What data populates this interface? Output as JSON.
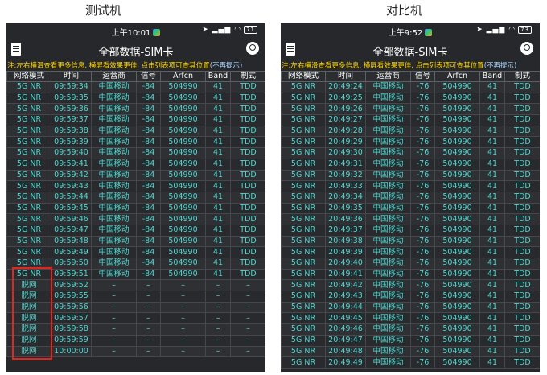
{
  "captions": {
    "left": "测试机",
    "right": "对比机"
  },
  "colors": {
    "table_text": "#4fd7d0",
    "note_text": "#ffd600",
    "highlight_border": "#e0261d",
    "background": "#26282b"
  },
  "left_phone": {
    "status_time": "上午10:01",
    "battery": "71",
    "title": "全部数据-SIM卡",
    "note": "注:左右横滑查看更多信息, 横屏看效果更佳, 点击列表项可查其位置",
    "note_link": "(不再提示)",
    "headers": [
      "网络模式",
      "时间",
      "运营商",
      "信号",
      "Arfcn",
      "Band",
      "制式"
    ],
    "rows": [
      [
        "5G NR",
        "09:59:34",
        "中国移动",
        "-84",
        "504990",
        "41",
        "TDD"
      ],
      [
        "5G NR",
        "09:59:35",
        "中国移动",
        "-84",
        "504990",
        "41",
        "TDD"
      ],
      [
        "5G NR",
        "09:59:36",
        "中国移动",
        "-84",
        "504990",
        "41",
        "TDD"
      ],
      [
        "5G NR",
        "09:59:37",
        "中国移动",
        "-84",
        "504990",
        "41",
        "TDD"
      ],
      [
        "5G NR",
        "09:59:38",
        "中国移动",
        "-84",
        "504990",
        "41",
        "TDD"
      ],
      [
        "5G NR",
        "09:59:39",
        "中国移动",
        "-84",
        "504990",
        "41",
        "TDD"
      ],
      [
        "5G NR",
        "09:59:40",
        "中国移动",
        "-84",
        "504990",
        "41",
        "TDD"
      ],
      [
        "5G NR",
        "09:59:41",
        "中国移动",
        "-84",
        "504990",
        "41",
        "TDD"
      ],
      [
        "5G NR",
        "09:59:42",
        "中国移动",
        "-84",
        "504990",
        "41",
        "TDD"
      ],
      [
        "5G NR",
        "09:59:43",
        "中国移动",
        "-84",
        "504990",
        "41",
        "TDD"
      ],
      [
        "5G NR",
        "09:59:44",
        "中国移动",
        "-84",
        "504990",
        "41",
        "TDD"
      ],
      [
        "5G NR",
        "09:59:45",
        "中国移动",
        "-84",
        "504990",
        "41",
        "TDD"
      ],
      [
        "5G NR",
        "09:59:46",
        "中国移动",
        "-84",
        "504990",
        "41",
        "TDD"
      ],
      [
        "5G NR",
        "09:59:47",
        "中国移动",
        "-84",
        "504990",
        "41",
        "TDD"
      ],
      [
        "5G NR",
        "09:59:48",
        "中国移动",
        "-84",
        "504990",
        "41",
        "TDD"
      ],
      [
        "5G NR",
        "09:59:49",
        "中国移动",
        "-84",
        "504990",
        "41",
        "TDD"
      ],
      [
        "5G NR",
        "09:59:50",
        "中国移动",
        "-84",
        "504990",
        "41",
        "TDD"
      ],
      [
        "5G NR",
        "09:59:51",
        "中国移动",
        "-84",
        "504990",
        "41",
        "TDD"
      ],
      [
        "脱网",
        "09:59:52",
        "–",
        "–",
        "–",
        "–",
        "–"
      ],
      [
        "脱网",
        "09:59:55",
        "–",
        "–",
        "–",
        "–",
        "–"
      ],
      [
        "脱网",
        "09:59:56",
        "–",
        "–",
        "–",
        "–",
        "–"
      ],
      [
        "脱网",
        "09:59:57",
        "–",
        "–",
        "–",
        "–",
        "–"
      ],
      [
        "脱网",
        "09:59:58",
        "–",
        "–",
        "–",
        "–",
        "–"
      ],
      [
        "脱网",
        "09:59:59",
        "–",
        "–",
        "–",
        "–",
        "–"
      ],
      [
        "脱网",
        "10:00:00",
        "–",
        "–",
        "–",
        "–",
        "–"
      ]
    ]
  },
  "right_phone": {
    "status_time": "上午9:52",
    "battery": "73",
    "title": "全部数据-SIM卡",
    "note": "注:左右横滑查看更多信息, 横屏看效果更佳, 点击列表项可查其位置",
    "note_link": "(不再提示)",
    "headers": [
      "网络模式",
      "时间",
      "运营商",
      "信号",
      "Arfcn",
      "Band",
      "制式"
    ],
    "rows": [
      [
        "5G NR",
        "20:49:24",
        "中国移动",
        "-76",
        "504990",
        "41",
        "TDD"
      ],
      [
        "5G NR",
        "20:49:25",
        "中国移动",
        "-76",
        "504990",
        "41",
        "TDD"
      ],
      [
        "5G NR",
        "20:49:26",
        "中国移动",
        "-76",
        "504990",
        "41",
        "TDD"
      ],
      [
        "5G NR",
        "20:49:27",
        "中国移动",
        "-76",
        "504990",
        "41",
        "TDD"
      ],
      [
        "5G NR",
        "20:49:28",
        "中国移动",
        "-76",
        "504990",
        "41",
        "TDD"
      ],
      [
        "5G NR",
        "20:49:29",
        "中国移动",
        "-76",
        "504990",
        "41",
        "TDD"
      ],
      [
        "5G NR",
        "20:49:30",
        "中国移动",
        "-76",
        "504990",
        "41",
        "TDD"
      ],
      [
        "5G NR",
        "20:49:31",
        "中国移动",
        "-76",
        "504990",
        "41",
        "TDD"
      ],
      [
        "5G NR",
        "20:49:32",
        "中国移动",
        "-76",
        "504990",
        "41",
        "TDD"
      ],
      [
        "5G NR",
        "20:49:33",
        "中国移动",
        "-76",
        "504990",
        "41",
        "TDD"
      ],
      [
        "5G NR",
        "20:49:34",
        "中国移动",
        "-76",
        "504990",
        "41",
        "TDD"
      ],
      [
        "5G NR",
        "20:49:35",
        "中国移动",
        "-76",
        "504990",
        "41",
        "TDD"
      ],
      [
        "5G NR",
        "20:49:36",
        "中国移动",
        "-76",
        "504990",
        "41",
        "TDD"
      ],
      [
        "5G NR",
        "20:49:37",
        "中国移动",
        "-76",
        "504990",
        "41",
        "TDD"
      ],
      [
        "5G NR",
        "20:49:38",
        "中国移动",
        "-76",
        "504990",
        "41",
        "TDD"
      ],
      [
        "5G NR",
        "20:49:39",
        "中国移动",
        "-76",
        "504990",
        "41",
        "TDD"
      ],
      [
        "5G NR",
        "20:49:40",
        "中国移动",
        "-76",
        "504990",
        "41",
        "TDD"
      ],
      [
        "5G NR",
        "20:49:41",
        "中国移动",
        "-76",
        "504990",
        "41",
        "TDD"
      ],
      [
        "5G NR",
        "20:49:42",
        "中国移动",
        "-76",
        "504990",
        "41",
        "TDD"
      ],
      [
        "5G NR",
        "20:49:43",
        "中国移动",
        "-76",
        "504990",
        "41",
        "TDD"
      ],
      [
        "5G NR",
        "20:49:44",
        "中国移动",
        "-76",
        "504990",
        "41",
        "TDD"
      ],
      [
        "5G NR",
        "20:49:45",
        "中国移动",
        "-76",
        "504990",
        "41",
        "TDD"
      ],
      [
        "5G NR",
        "20:49:46",
        "中国移动",
        "-76",
        "504990",
        "41",
        "TDD"
      ],
      [
        "5G NR",
        "20:49:47",
        "中国移动",
        "-76",
        "504990",
        "41",
        "TDD"
      ],
      [
        "5G NR",
        "20:49:48",
        "中国移动",
        "-76",
        "504990",
        "41",
        "TDD"
      ],
      [
        "5G NR",
        "20:49:49",
        "中国移动",
        "-76",
        "504990",
        "41",
        "TDD"
      ]
    ]
  }
}
